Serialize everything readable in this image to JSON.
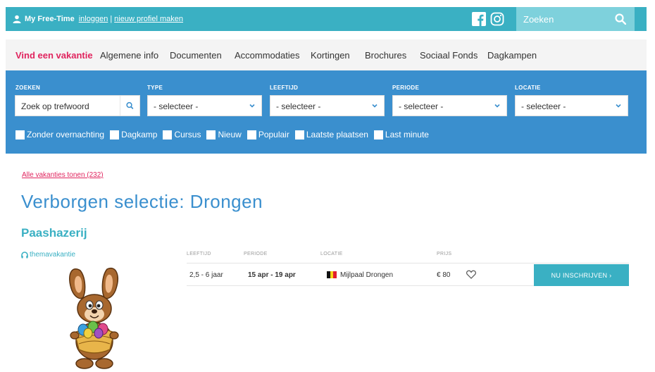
{
  "topbar": {
    "brand": "My Free-Time",
    "login": "inloggen",
    "separator": "|",
    "new_profile": "nieuw profiel maken",
    "search_placeholder": "Zoeken"
  },
  "nav": {
    "items": [
      {
        "label": "Vind een vakantie",
        "active": true
      },
      {
        "label": "Algemene info"
      },
      {
        "label": "Documenten"
      },
      {
        "label": "Accommodaties"
      },
      {
        "label": "Kortingen"
      },
      {
        "label": "Brochures"
      },
      {
        "label": "Sociaal Fonds"
      },
      {
        "label": "Dagkampen"
      }
    ]
  },
  "filters": {
    "search": {
      "label": "ZOEKEN",
      "placeholder": "Zoek op trefwoord"
    },
    "type": {
      "label": "TYPE",
      "value": "- selecteer -"
    },
    "age": {
      "label": "LEEFTIJD",
      "value": "- selecteer -"
    },
    "period": {
      "label": "PERIODE",
      "value": "- selecteer -"
    },
    "location": {
      "label": "LOCATIE",
      "value": "- selecteer -"
    },
    "checkboxes": [
      "Zonder overnachting",
      "Dagkamp",
      "Cursus",
      "Nieuw",
      "Populair",
      "Laatste plaatsen",
      "Last minute"
    ]
  },
  "content": {
    "all_link": "Alle vakanties tonen (232)",
    "title": "Verborgen selectie: Drongen",
    "item": {
      "title": "Paashazerij",
      "tag": "themavakantie",
      "headers": {
        "age": "LEEFTIJD",
        "period": "PERIODE",
        "location": "LOCATIE",
        "price": "PRIJS"
      },
      "row": {
        "age": "2,5 - 6 jaar",
        "period": "15 apr - 19 apr",
        "location": "Mijlpaal Drongen",
        "price": "€ 80",
        "cta": "NU INSCHRIJVEN ›"
      }
    }
  },
  "colors": {
    "teal": "#3ab0c3",
    "blue": "#3a8fce",
    "pink": "#e0245e"
  }
}
